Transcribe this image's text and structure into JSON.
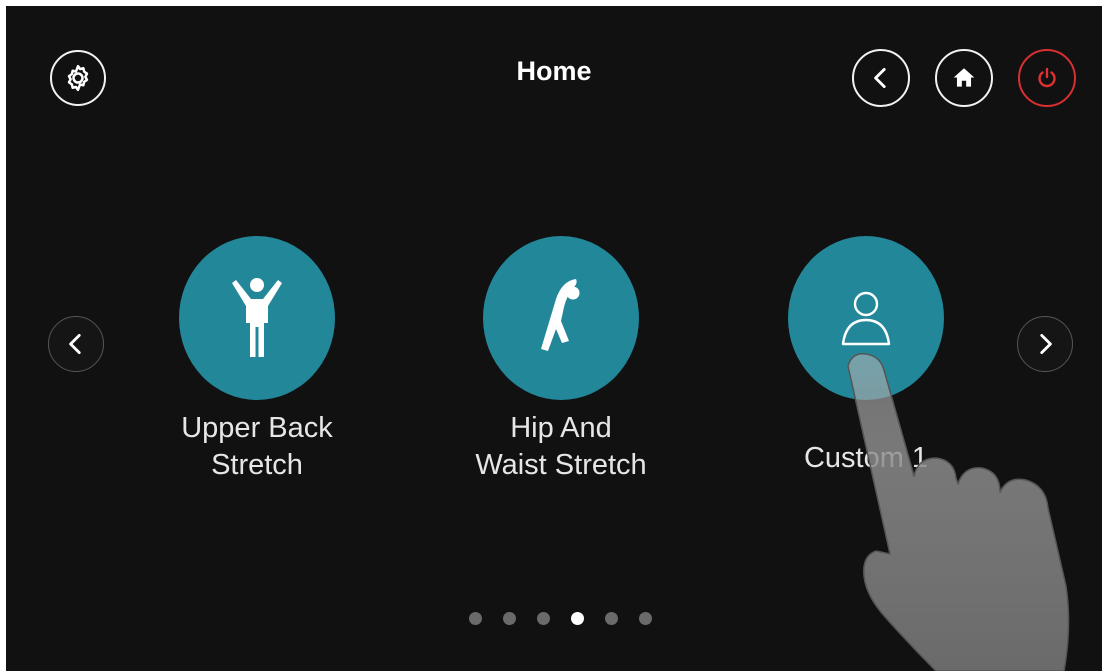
{
  "header": {
    "title": "Home",
    "settings_icon": "gear-icon",
    "back_icon": "chevron-left-icon",
    "home_icon": "home-icon",
    "power_icon": "power-icon",
    "power_color": "#e03030"
  },
  "carousel": {
    "accent": "#23879a",
    "prev_icon": "chevron-left-icon",
    "next_icon": "chevron-right-icon",
    "items": [
      {
        "label": "Upper Back\nStretch",
        "icon": "person-arms-up-icon"
      },
      {
        "label": "Hip And\nWaist Stretch",
        "icon": "person-side-bend-icon"
      },
      {
        "label": "Custom 1",
        "icon": "user-outline-icon"
      }
    ]
  },
  "pagination": {
    "total": 6,
    "current": 4
  },
  "overlay": {
    "icon": "pointing-hand-icon"
  }
}
